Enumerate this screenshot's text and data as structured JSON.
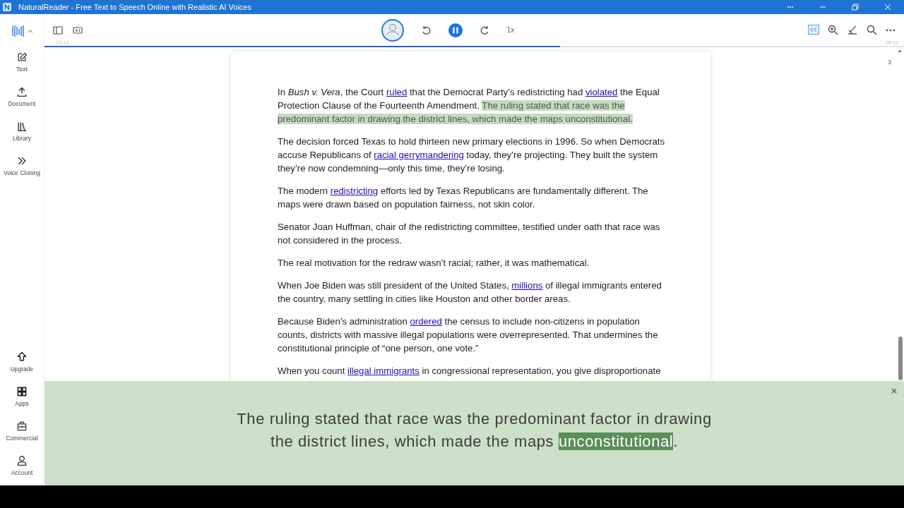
{
  "window": {
    "title": "NaturalReader - Free Text to Speech Online with Realistic AI Voices"
  },
  "sidebar": {
    "top_items": [
      {
        "label": "Text"
      },
      {
        "label": "Document"
      },
      {
        "label": "Library"
      },
      {
        "label": "Voice Cloning"
      }
    ],
    "bottom_items": [
      {
        "label": "Upgrade"
      },
      {
        "label": "Apps"
      },
      {
        "label": "Commercial"
      },
      {
        "label": "Account"
      }
    ]
  },
  "player": {
    "speed": "1x",
    "elapsed": "03:13",
    "total": "05:21",
    "level": 0.6,
    "playing": true,
    "captions_on": true
  },
  "document": {
    "page_number": "3",
    "paragraphs": [
      [
        {
          "kind": "plain",
          "text": "In "
        },
        {
          "kind": "italic",
          "text": "Bush v. Vera"
        },
        {
          "kind": "plain",
          "text": ", the Court "
        },
        {
          "kind": "link",
          "text": "ruled"
        },
        {
          "kind": "plain",
          "text": " that the Democrat Party’s redistricting had "
        },
        {
          "kind": "link",
          "text": "violated"
        },
        {
          "kind": "plain",
          "text": " the Equal Protection Clause of the Fourteenth Amendment. "
        },
        {
          "kind": "highlight",
          "text": "The ruling stated that race was the predominant factor in drawing the district lines, which made the maps unconstitutional."
        }
      ],
      [
        {
          "kind": "plain",
          "text": "The decision forced Texas to hold thirteen new primary elections in 1996. So when Democrats accuse Republicans of "
        },
        {
          "kind": "link",
          "text": "racial gerrymandering"
        },
        {
          "kind": "plain",
          "text": " today, they’re projecting. They built the system they’re now condemning—only this time, they’re losing."
        }
      ],
      [
        {
          "kind": "plain",
          "text": "The modern "
        },
        {
          "kind": "link",
          "text": "redistricting"
        },
        {
          "kind": "plain",
          "text": " efforts led by Texas Republicans are fundamentally different. The maps were drawn based on population fairness, not skin color."
        }
      ],
      [
        {
          "kind": "plain",
          "text": "Senator Joan Huffman, chair of the redistricting committee, testified under oath that race was not considered in the process."
        }
      ],
      [
        {
          "kind": "plain",
          "text": "The real motivation for the redraw wasn’t racial; rather, it was mathematical."
        }
      ],
      [
        {
          "kind": "plain",
          "text": "When Joe Biden was still president of the United States, "
        },
        {
          "kind": "link",
          "text": "millions"
        },
        {
          "kind": "plain",
          "text": " of illegal immigrants entered the country, many settling in cities like Houston and other border areas."
        }
      ],
      [
        {
          "kind": "plain",
          "text": "Because Biden’s administration "
        },
        {
          "kind": "link",
          "text": "ordered"
        },
        {
          "kind": "plain",
          "text": " the census to include non-citizens in population counts, districts with massive illegal populations were overrepresented. That undermines the constitutional principle of “one person, one vote.”"
        }
      ],
      [
        {
          "kind": "plain",
          "text": "When you count "
        },
        {
          "kind": "link",
          "text": "illegal immigrants"
        },
        {
          "kind": "plain",
          "text": " in congressional representation, you give disproportionate"
        }
      ]
    ]
  },
  "caption": {
    "segments": [
      {
        "text": "The ruling stated that race was the predominant factor in drawing the district lines, which made the maps ",
        "current": false
      },
      {
        "text": "unconstitutional",
        "current": true
      },
      {
        "text": ".",
        "current": false
      }
    ]
  }
}
